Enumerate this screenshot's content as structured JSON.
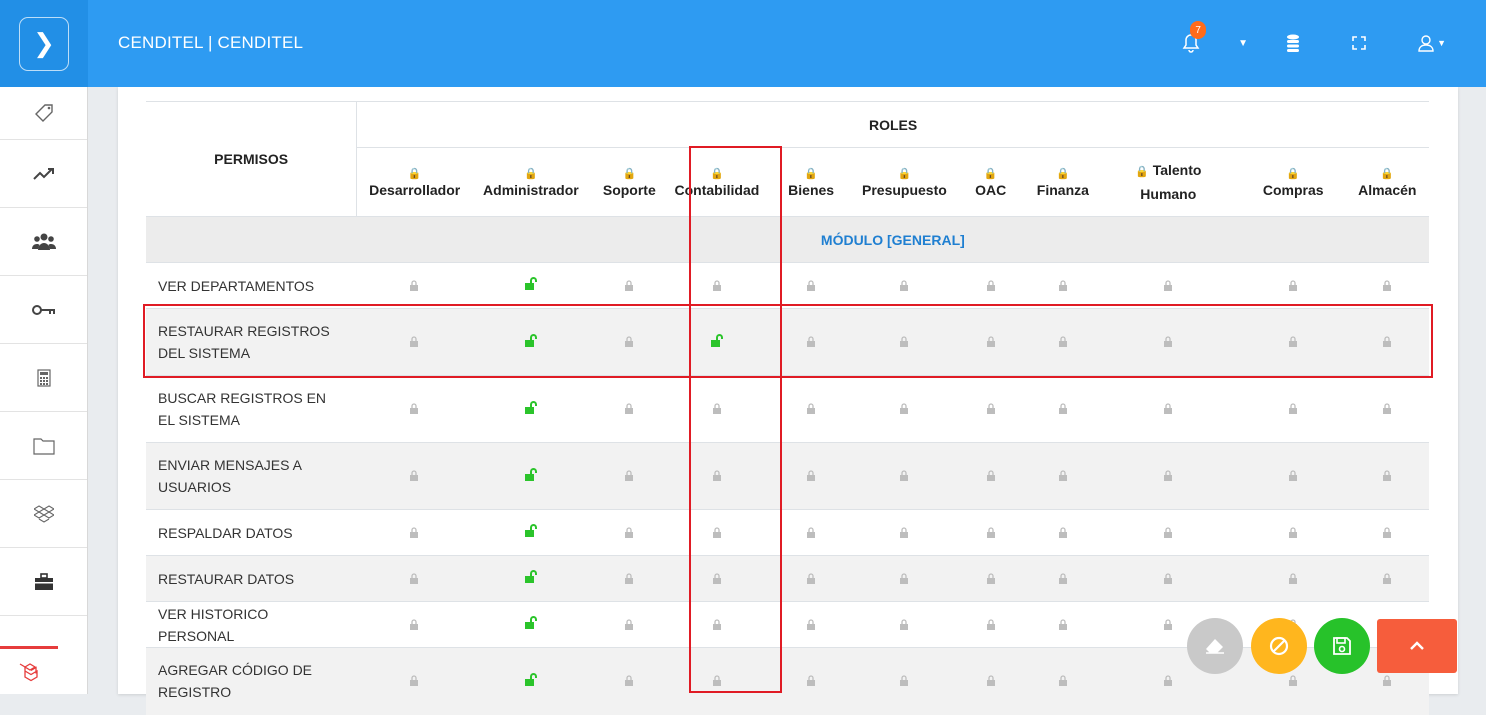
{
  "header": {
    "brand": "CENDITEL | CENDITEL",
    "notification_count": "7",
    "icons": [
      "chevron-right-icon",
      "bell-icon",
      "caret-down-icon",
      "database-icon",
      "fullscreen-icon",
      "user-icon"
    ]
  },
  "sidebar": {
    "items": [
      "tag-icon",
      "trend-up-icon",
      "users-icon",
      "key-icon",
      "calculator-icon",
      "folder-icon",
      "dropbox-icon",
      "briefcase-icon"
    ],
    "bottom_icon": "laravel-icon"
  },
  "table": {
    "permisos_header": "PERMISOS",
    "roles_header": "ROLES",
    "roles": [
      [
        "Desarrollador",
        ""
      ],
      [
        "Administrador",
        ""
      ],
      [
        "Soporte",
        ""
      ],
      [
        "Contabilidad",
        ""
      ],
      [
        "Bienes",
        ""
      ],
      [
        "Presupuesto",
        ""
      ],
      [
        "OAC",
        ""
      ],
      [
        "Finanza",
        ""
      ],
      [
        "Talento",
        "Humano"
      ],
      [
        "Compras",
        ""
      ],
      [
        "Almacén",
        ""
      ]
    ],
    "module_label": "MÓDULO [GENERAL]",
    "rows": [
      {
        "label": "VER DEPARTAMENTOS",
        "granted": [
          "Administrador"
        ]
      },
      {
        "label": "RESTAURAR REGISTROS DEL SISTEMA",
        "granted": [
          "Administrador",
          "Contabilidad"
        ]
      },
      {
        "label": "BUSCAR REGISTROS EN EL SISTEMA",
        "granted": [
          "Administrador"
        ]
      },
      {
        "label": "ENVIAR MENSAJES A USUARIOS",
        "granted": [
          "Administrador"
        ]
      },
      {
        "label": "RESPALDAR DATOS",
        "granted": [
          "Administrador"
        ]
      },
      {
        "label": "RESTAURAR DATOS",
        "granted": [
          "Administrador"
        ]
      },
      {
        "label": "VER HISTORICO PERSONAL",
        "granted": [
          "Administrador"
        ]
      },
      {
        "label": "AGREGAR CÓDIGO DE REGISTRO",
        "granted": [
          "Administrador"
        ]
      }
    ]
  },
  "actions": [
    "eraser-icon",
    "cancel-icon",
    "save-icon",
    "scroll-up-icon"
  ],
  "colors": {
    "topbar": "#2e9bf2",
    "granted": "#2bc42b",
    "module_text": "#1f7fd1",
    "highlight": "#e01b24",
    "save": "#27c22a",
    "cancel": "#ffb61e",
    "scroll_up": "#f65d3c"
  }
}
